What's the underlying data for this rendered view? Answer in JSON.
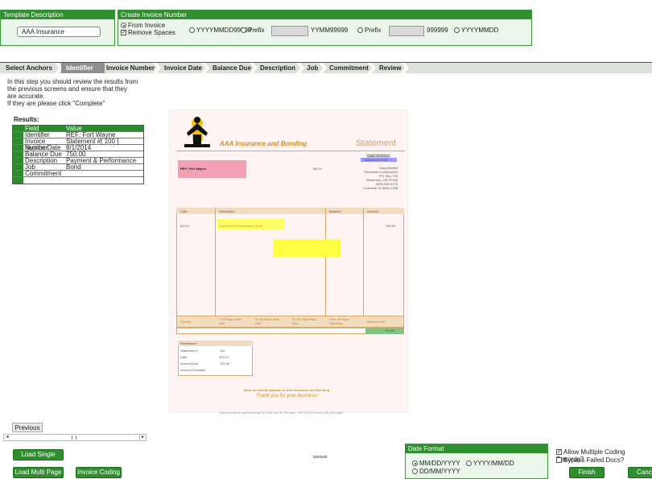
{
  "template": {
    "title": "Template Description",
    "value": "AAA Insurance"
  },
  "invoice_number": {
    "title": "Create Invoice Number",
    "opt_from_invoice": "From Invoice",
    "opt_remove_spaces": "Remove Spaces",
    "opt_fmt1": "YYYYMMDD99999",
    "opt_prefix": "Prefix",
    "fmt2": "YYMM99999",
    "fmt3": "999999",
    "opt_fmt4": "YYYYMMDD"
  },
  "tabs": [
    "Select Anchors",
    "Identifier",
    "Invoice Number",
    "Invoice Date",
    "Balance Due",
    "Description",
    "Job",
    "Commitment",
    "Review"
  ],
  "instructions": [
    "In this step you should review the results from",
    "the previous screens and ensure that they",
    "are accurate.",
    "If they are please click \"Complete\""
  ],
  "results": {
    "label": "Results:",
    "headers": [
      "Field",
      "Value"
    ],
    "rows": [
      {
        "field": "Identifier",
        "value": "REF: Fort Wayne"
      },
      {
        "field": "Invoice Number",
        "value": "Statement #[ 100 ]"
      },
      {
        "field": "Invoice Date",
        "value": "8/1/2014"
      },
      {
        "field": "Balance Due",
        "value": "750.00"
      },
      {
        "field": "Description",
        "value": "Payment & Performance Bond"
      },
      {
        "field": "Job",
        "value": ""
      },
      {
        "field": "Commitment",
        "value": ""
      },
      {
        "field": "",
        "value": ""
      }
    ]
  },
  "doc": {
    "company": "AAA Insurance and Bonding",
    "title": "Statement",
    "date_line": "Date: 8/1/2014",
    "stmt_line": "Statement #:100",
    "ref": "REF: Fort Wayne",
    "bill_to": "Bill To:",
    "addr": [
      "Doug Moffett",
      "Timberline Construction",
      "P.O. Box 728",
      "Beaverton, OR 97008",
      "(503) 690-6775",
      "Customer ID 5546-1238"
    ],
    "cols": [
      "Date",
      "Description",
      "Balance",
      "Amount"
    ],
    "line_date": "8/1/14",
    "line_desc": "Payment & Performance Bond",
    "line_amount": "750.00",
    "aging": [
      "Current",
      "1-30 Days Past Due",
      "31-60 Days Past Due",
      "61-90 Days Past Due",
      "Over 90 Days Past Due",
      "Amount Due"
    ],
    "amount_due": "750.00",
    "remit_title": "Remittance",
    "remit_rows": [
      [
        "Statement #",
        "110"
      ],
      [
        "Date",
        "8/1/14"
      ],
      [
        "Amount Due",
        "750.00"
      ],
      [
        "Amount Enclosed",
        ""
      ]
    ],
    "note": "Make all checks payable to AAA Insurance and Bonding",
    "thanks": "Thank you for your business!",
    "footer": "AAA Insurance and Bonding  241 SW 3rd St, Portland, OR 97221  Phone 503-242-5889"
  },
  "buttons": {
    "previous": "Previous",
    "load_single": "Load Single Page",
    "load_multi": "Load Multi Page",
    "invoice_coding": "Invoice Coding",
    "finish": "Finish",
    "cancel": "Cancel"
  },
  "center_text": "xxxxxxx",
  "date_format": {
    "title": "Date Format",
    "opt1": "MM/DD/YYYY",
    "opt2": "YYYY/MM/DD",
    "opt3": "DD/MM/YYYY"
  },
  "options": {
    "allow_multi": "Allow Multiple Coding Records?",
    "bypass": "Bypass Failed Docs?"
  },
  "colors": {
    "green": "#2f8f2f",
    "highlight_yellow": "#ffff66",
    "highlight_pink": "#f4a0b4",
    "highlight_blue": "#9999ff",
    "orange": "#e0a030"
  }
}
